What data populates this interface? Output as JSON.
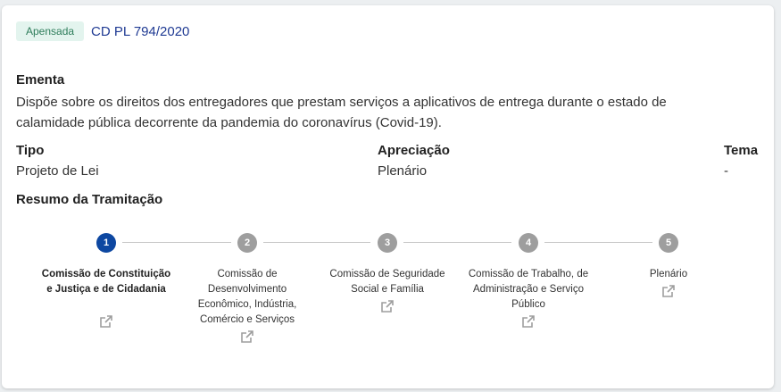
{
  "header": {
    "badge": "Apensada",
    "identifier": "CD PL 794/2020"
  },
  "ementa": {
    "label": "Ementa",
    "text": "Dispõe sobre os direitos dos entregadores que prestam serviços a aplicativos de entrega durante o estado de calamidade pública decorrente da pandemia do coronavírus (Covid-19)."
  },
  "fields": {
    "tipo": {
      "label": "Tipo",
      "value": "Projeto de Lei"
    },
    "apreciacao": {
      "label": "Apreciação",
      "value": "Plenário"
    },
    "tema": {
      "label": "Tema",
      "value": "-"
    }
  },
  "resumo": {
    "label": "Resumo da Tramitação",
    "steps": [
      {
        "number": "1",
        "label": "Comissão de Constituição e Justiça e de Cidadania",
        "active": true
      },
      {
        "number": "2",
        "label": "Comissão de Desenvolvimento Econômico, Indústria, Comércio e Serviços",
        "active": false
      },
      {
        "number": "3",
        "label": "Comissão de Seguridade Social e Família",
        "active": false
      },
      {
        "number": "4",
        "label": "Comissão de Trabalho, de Administração e Serviço Público",
        "active": false
      },
      {
        "number": "5",
        "label": "Plenário",
        "active": false
      }
    ]
  },
  "colors": {
    "active_step": "#0d47a1",
    "inactive_step": "#9e9e9e",
    "badge_bg": "#e3f4ee",
    "badge_text": "#2e7d5b",
    "identifier": "#1f3a93"
  },
  "icons": {
    "external_link": "external-link-icon"
  }
}
